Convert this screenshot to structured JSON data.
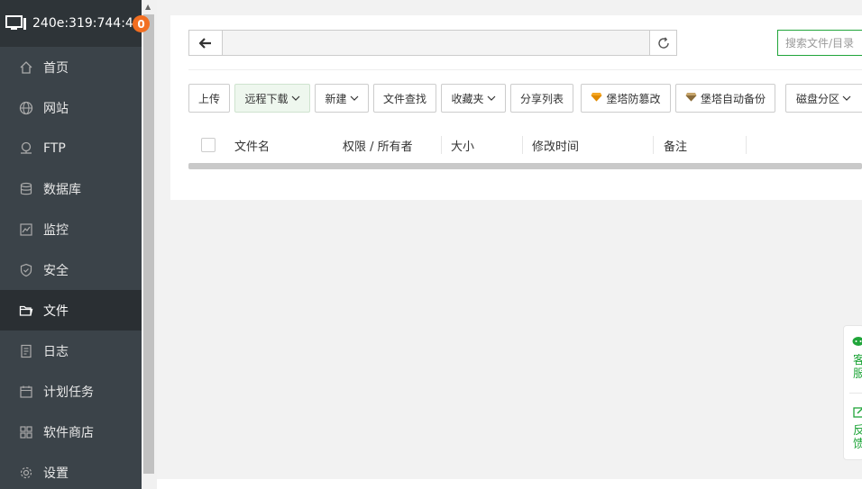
{
  "header": {
    "host": "240e:319:744:4...",
    "badge": "0"
  },
  "sidebar": {
    "items": [
      {
        "label": "首页",
        "icon": "home-icon"
      },
      {
        "label": "网站",
        "icon": "globe-icon"
      },
      {
        "label": "FTP",
        "icon": "ftp-icon"
      },
      {
        "label": "数据库",
        "icon": "database-icon"
      },
      {
        "label": "监控",
        "icon": "monitor-icon"
      },
      {
        "label": "安全",
        "icon": "shield-icon"
      },
      {
        "label": "文件",
        "icon": "folder-icon",
        "active": true
      },
      {
        "label": "日志",
        "icon": "log-icon"
      },
      {
        "label": "计划任务",
        "icon": "calendar-icon"
      },
      {
        "label": "软件商店",
        "icon": "grid-icon"
      },
      {
        "label": "设置",
        "icon": "gear-icon"
      }
    ]
  },
  "pathbar": {
    "path": "",
    "search_placeholder": "搜索文件/目录"
  },
  "toolbar": {
    "upload": "上传",
    "remote_download": "远程下载",
    "new": "新建",
    "file_search": "文件查找",
    "favorites": "收藏夹",
    "share_list": "分享列表",
    "tamper_proof": "堡塔防篡改",
    "auto_backup": "堡塔自动备份",
    "disk_partition": "磁盘分区"
  },
  "table": {
    "columns": [
      "文件名",
      "权限 / 所有者",
      "大小",
      "修改时间",
      "备注"
    ]
  },
  "float": {
    "service": "客服",
    "feedback": "反馈"
  },
  "colors": {
    "accent": "#20a53a",
    "sidebar": "#3b4349",
    "badge": "#f26e21"
  }
}
